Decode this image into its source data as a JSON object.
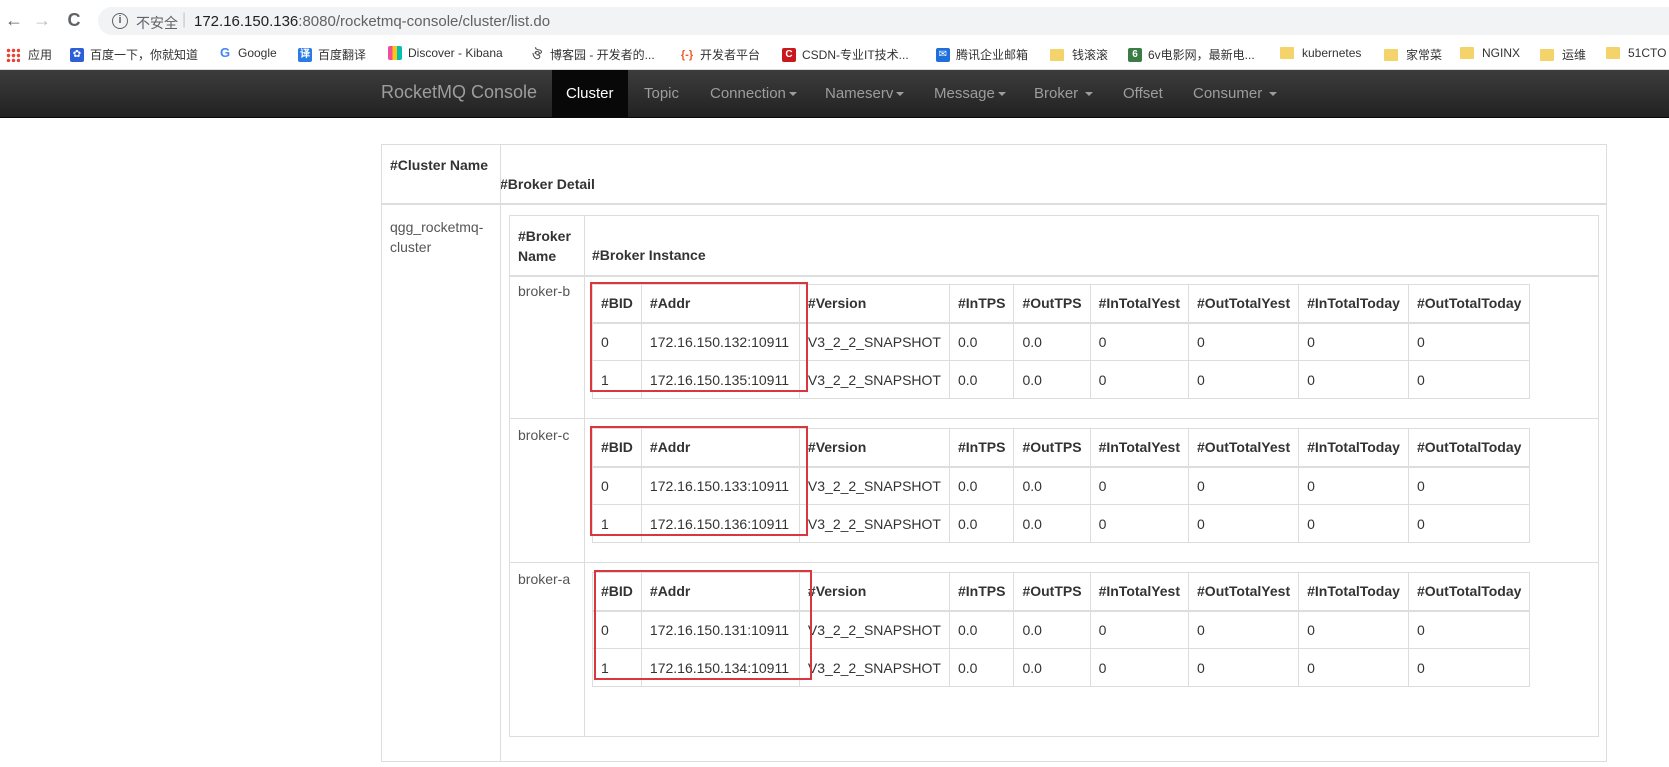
{
  "browser": {
    "insecure_label": "不安全",
    "url_host": "172.16.150.136",
    "url_rest": ":8080/rocketmq-console/cluster/list.do",
    "back": "←",
    "forward": "→",
    "reload": "C"
  },
  "bookmarks": [
    {
      "label": "应用"
    },
    {
      "label": "百度一下，你就知道"
    },
    {
      "label": "Google"
    },
    {
      "label": "百度翻译"
    },
    {
      "label": "Discover - Kibana"
    },
    {
      "label": "博客园 - 开发者的..."
    },
    {
      "label": "开发者平台"
    },
    {
      "label": "CSDN-专业IT技术..."
    },
    {
      "label": "腾讯企业邮箱"
    },
    {
      "label": "钱滚滚"
    },
    {
      "label": "6v电影网，最新电..."
    },
    {
      "label": "kubernetes"
    },
    {
      "label": "家常菜"
    },
    {
      "label": "NGINX"
    },
    {
      "label": "运维"
    },
    {
      "label": "51CTO"
    }
  ],
  "navbar": {
    "brand": "RocketMQ Console",
    "items": [
      {
        "label": "Cluster",
        "active": true
      },
      {
        "label": "Topic"
      },
      {
        "label": "Connection"
      },
      {
        "label": "Nameserv"
      },
      {
        "label": "Message"
      },
      {
        "label": "Broker "
      },
      {
        "label": "Offset"
      },
      {
        "label": "Consumer "
      }
    ]
  },
  "table": {
    "col_cluster": "#Cluster Name",
    "col_detail": "#Broker Detail",
    "cluster_name": "qgg_rocketmq-cluster",
    "col_broker_name": "#Broker Name",
    "col_broker_instance": "#Broker Instance",
    "instance_headers": [
      "#BID",
      "#Addr",
      "#Version",
      "#InTPS",
      "#OutTPS",
      "#InTotalYest",
      "#OutTotalYest",
      "#InTotalToday",
      "#OutTotalToday"
    ],
    "brokers": [
      {
        "name": "broker-b",
        "rows": [
          [
            "0",
            "172.16.150.132:10911",
            "V3_2_2_SNAPSHOT",
            "0.0",
            "0.0",
            "0",
            "0",
            "0",
            "0"
          ],
          [
            "1",
            "172.16.150.135:10911",
            "V3_2_2_SNAPSHOT",
            "0.0",
            "0.0",
            "0",
            "0",
            "0",
            "0"
          ]
        ]
      },
      {
        "name": "broker-c",
        "rows": [
          [
            "0",
            "172.16.150.133:10911",
            "V3_2_2_SNAPSHOT",
            "0.0",
            "0.0",
            "0",
            "0",
            "0",
            "0"
          ],
          [
            "1",
            "172.16.150.136:10911",
            "V3_2_2_SNAPSHOT",
            "0.0",
            "0.0",
            "0",
            "0",
            "0",
            "0"
          ]
        ]
      },
      {
        "name": "broker-a",
        "rows": [
          [
            "0",
            "172.16.150.131:10911",
            "V3_2_2_SNAPSHOT",
            "0.0",
            "0.0",
            "0",
            "0",
            "0",
            "0"
          ],
          [
            "1",
            "172.16.150.134:10911",
            "V3_2_2_SNAPSHOT",
            "0.0",
            "0.0",
            "0",
            "0",
            "0",
            "0"
          ]
        ]
      }
    ]
  },
  "colors": {
    "highlight": "#d9363e",
    "navbar": "#222222"
  }
}
